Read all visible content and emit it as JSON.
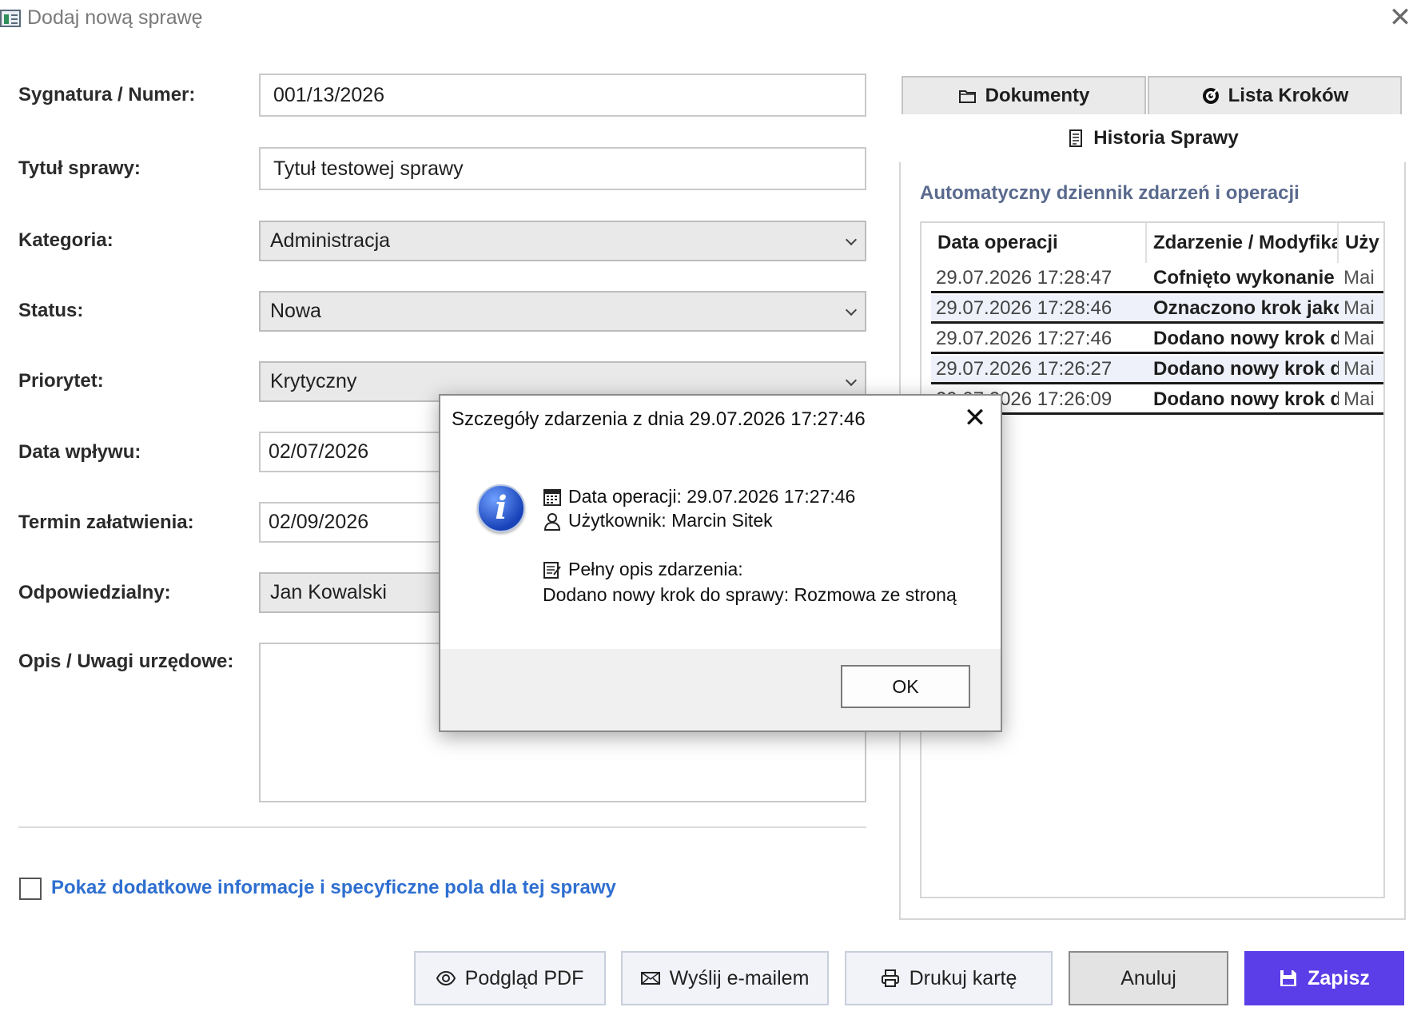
{
  "window": {
    "title": "Dodaj nową sprawę"
  },
  "form": {
    "sygnatura": {
      "label": "Sygnatura / Numer:",
      "value": "001/13/2026"
    },
    "tytul": {
      "label": "Tytuł sprawy:",
      "value": "Tytuł testowej sprawy"
    },
    "kategoria": {
      "label": "Kategoria:",
      "value": "Administracja"
    },
    "status": {
      "label": "Status:",
      "value": "Nowa"
    },
    "priorytet": {
      "label": "Priorytet:",
      "value": "Krytyczny"
    },
    "data_wplywu": {
      "label": "Data wpływu:",
      "value": "02/07/2026"
    },
    "termin": {
      "label": "Termin załatwienia:",
      "value": "02/09/2026"
    },
    "odpowiedzialny": {
      "label": "Odpowiedzialny:",
      "value": "Jan Kowalski"
    },
    "opis": {
      "label": "Opis / Uwagi urzędowe:"
    },
    "extra_checkbox_label": "Pokaż dodatkowe informacje i specyficzne pola dla tej sprawy"
  },
  "panel": {
    "tabs": {
      "docs": "Dokumenty",
      "steps": "Lista Kroków",
      "history": "Historia Sprawy"
    },
    "subtitle": "Automatyczny dziennik zdarzeń i operacji",
    "columns": [
      "Data operacji",
      "Zdarzenie / Modyfika",
      "Uży"
    ],
    "rows": [
      {
        "date": "29.07.2026 17:28:47",
        "event": "Cofnięto wykonanie k",
        "user": "Mai"
      },
      {
        "date": "29.07.2026 17:28:46",
        "event": "Oznaczono krok jako",
        "user": "Mai"
      },
      {
        "date": "29.07.2026 17:27:46",
        "event": "Dodano nowy krok d",
        "user": "Mai"
      },
      {
        "date": "29.07.2026 17:26:27",
        "event": "Dodano nowy krok d",
        "user": "Mai"
      },
      {
        "date": "29.07.2026 17:26:09",
        "event": "Dodano nowy krok d",
        "user": "Mai"
      }
    ]
  },
  "buttons": {
    "pdf": "Podgląd PDF",
    "email": "Wyślij e-mailem",
    "print": "Drukuj kartę",
    "cancel": "Anuluj",
    "save": "Zapisz"
  },
  "modal": {
    "title": "Szczegóły zdarzenia z dnia 29.07.2026 17:27:46",
    "date_line": "Data operacji: 29.07.2026 17:27:46",
    "user_line": "Użytkownik: Marcin Sitek",
    "desc_header": "Pełny opis zdarzenia:",
    "desc_text": "Dodano nowy krok do sprawy: Rozmowa ze stroną",
    "ok": "OK"
  },
  "colors": {
    "accent": "#5b3ee8",
    "link": "#2f6fd0",
    "subtitle": "#5a6a8e"
  }
}
